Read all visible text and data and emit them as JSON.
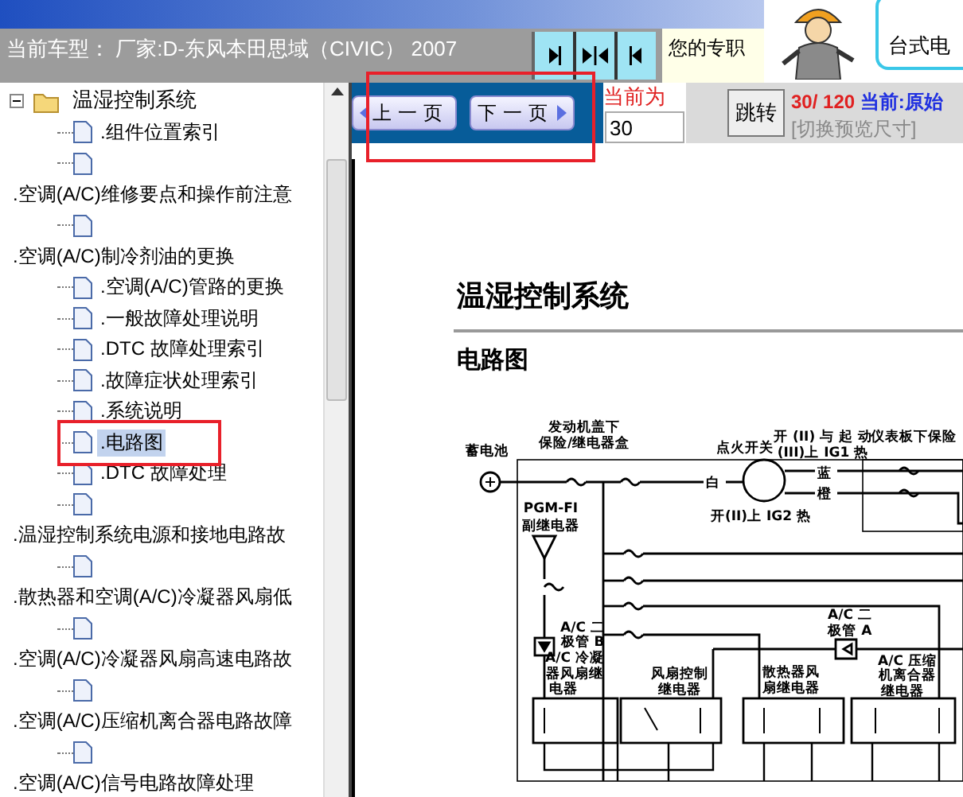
{
  "header": {
    "vehicle": "当前车型： 厂家:D-东风本田思域（CIVIC） 2007",
    "layout_buttons": [
      {
        "kind": "right"
      },
      {
        "kind": "both"
      },
      {
        "kind": "left"
      }
    ],
    "notice": "您的专职",
    "promo": "台式电"
  },
  "tree": {
    "label": "温湿控制系统",
    "expanded": true,
    "children": [
      {
        "label": ".组件位置索引",
        "selected": false
      },
      {
        "label": ".空调(A/C)维修要点和操作前注意",
        "selected": false
      },
      {
        "label": ".空调(A/C)制冷剂油的更换",
        "selected": false
      },
      {
        "label": ".空调(A/C)管路的更换",
        "selected": false
      },
      {
        "label": ".一般故障处理说明",
        "selected": false
      },
      {
        "label": ".DTC 故障处理索引",
        "selected": false
      },
      {
        "label": ".故障症状处理索引",
        "selected": false
      },
      {
        "label": ".系统说明",
        "selected": false
      },
      {
        "label": ".电路图",
        "selected": true
      },
      {
        "label": ".DTC 故障处理",
        "selected": false
      },
      {
        "label": ".温湿控制系统电源和接地电路故",
        "selected": false
      },
      {
        "label": ".散热器和空调(A/C)冷凝器风扇低",
        "selected": false
      },
      {
        "label": ".空调(A/C)冷凝器风扇高速电路故",
        "selected": false
      },
      {
        "label": ".空调(A/C)压缩机离合器电路故障",
        "selected": false
      },
      {
        "label": ".空调(A/C)信号电路故障处理",
        "selected": false
      }
    ]
  },
  "toolbar": {
    "prev": "上一页",
    "next": "下一页",
    "page_label": "当前为",
    "page_input": "30",
    "jump": "跳转",
    "page_count": "30/ 120",
    "mode_label": "当前:",
    "mode": "原始",
    "resize_link": "[切换预览尺寸]"
  },
  "document": {
    "title": "温湿控制系统",
    "subtitle": "电路图",
    "diagram_labels": [
      "蓄电池",
      "发动机盖下",
      "保险/继电器盒",
      "点火开关",
      "开 (II) 与 起 动",
      "(III)上 IG1 热",
      "仪表板下保险",
      "白",
      "蓝",
      "橙",
      "开(II)上 IG2 热",
      "PGM-FI",
      "副继电器",
      "A/C 二",
      "极管 B",
      "A/C 冷凝",
      "器风扇继",
      "电器",
      "风扇控制",
      "继电器",
      "散热器风",
      "扇继电器",
      "A/C 二",
      "极管 A",
      "A/C 压缩",
      "机离合器",
      "继电器"
    ]
  }
}
